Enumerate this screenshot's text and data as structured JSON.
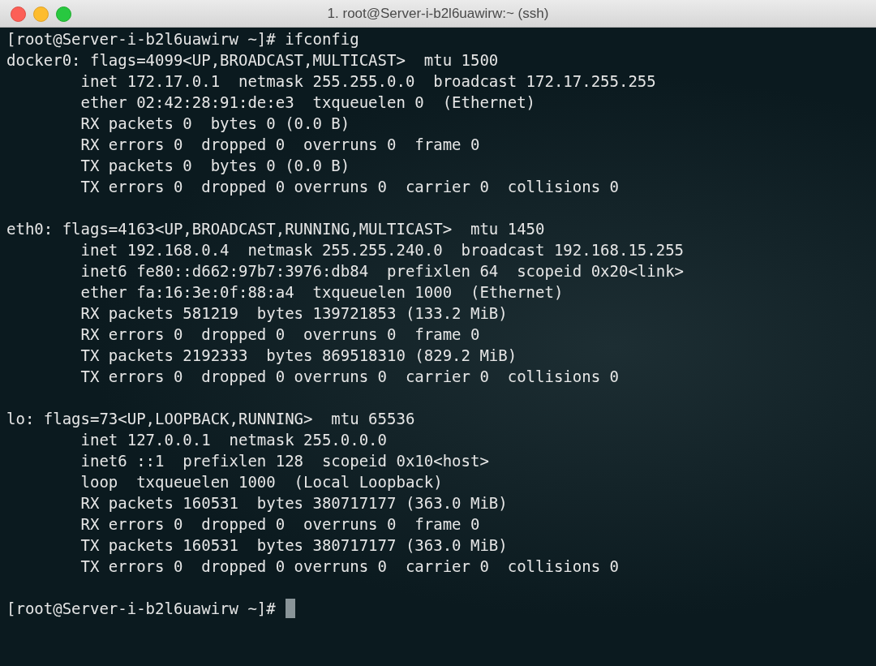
{
  "window": {
    "title": "1. root@Server-i-b2l6uawirw:~ (ssh)"
  },
  "terminal": {
    "blocks": [
      {
        "lines": [
          "[root@Server-i-b2l6uawirw ~]# ifconfig",
          "docker0: flags=4099<UP,BROADCAST,MULTICAST>  mtu 1500",
          "        inet 172.17.0.1  netmask 255.255.0.0  broadcast 172.17.255.255",
          "        ether 02:42:28:91:de:e3  txqueuelen 0  (Ethernet)",
          "        RX packets 0  bytes 0 (0.0 B)",
          "        RX errors 0  dropped 0  overruns 0  frame 0",
          "        TX packets 0  bytes 0 (0.0 B)",
          "        TX errors 0  dropped 0 overruns 0  carrier 0  collisions 0"
        ]
      },
      {
        "lines": [
          "eth0: flags=4163<UP,BROADCAST,RUNNING,MULTICAST>  mtu 1450",
          "        inet 192.168.0.4  netmask 255.255.240.0  broadcast 192.168.15.255",
          "        inet6 fe80::d662:97b7:3976:db84  prefixlen 64  scopeid 0x20<link>",
          "        ether fa:16:3e:0f:88:a4  txqueuelen 1000  (Ethernet)",
          "        RX packets 581219  bytes 139721853 (133.2 MiB)",
          "        RX errors 0  dropped 0  overruns 0  frame 0",
          "        TX packets 2192333  bytes 869518310 (829.2 MiB)",
          "        TX errors 0  dropped 0 overruns 0  carrier 0  collisions 0"
        ]
      },
      {
        "lines": [
          "lo: flags=73<UP,LOOPBACK,RUNNING>  mtu 65536",
          "        inet 127.0.0.1  netmask 255.0.0.0",
          "        inet6 ::1  prefixlen 128  scopeid 0x10<host>",
          "        loop  txqueuelen 1000  (Local Loopback)",
          "        RX packets 160531  bytes 380717177 (363.0 MiB)",
          "        RX errors 0  dropped 0  overruns 0  frame 0",
          "        TX packets 160531  bytes 380717177 (363.0 MiB)",
          "        TX errors 0  dropped 0 overruns 0  carrier 0  collisions 0"
        ]
      }
    ],
    "prompt": "[root@Server-i-b2l6uawirw ~]#",
    "cursor": true
  }
}
